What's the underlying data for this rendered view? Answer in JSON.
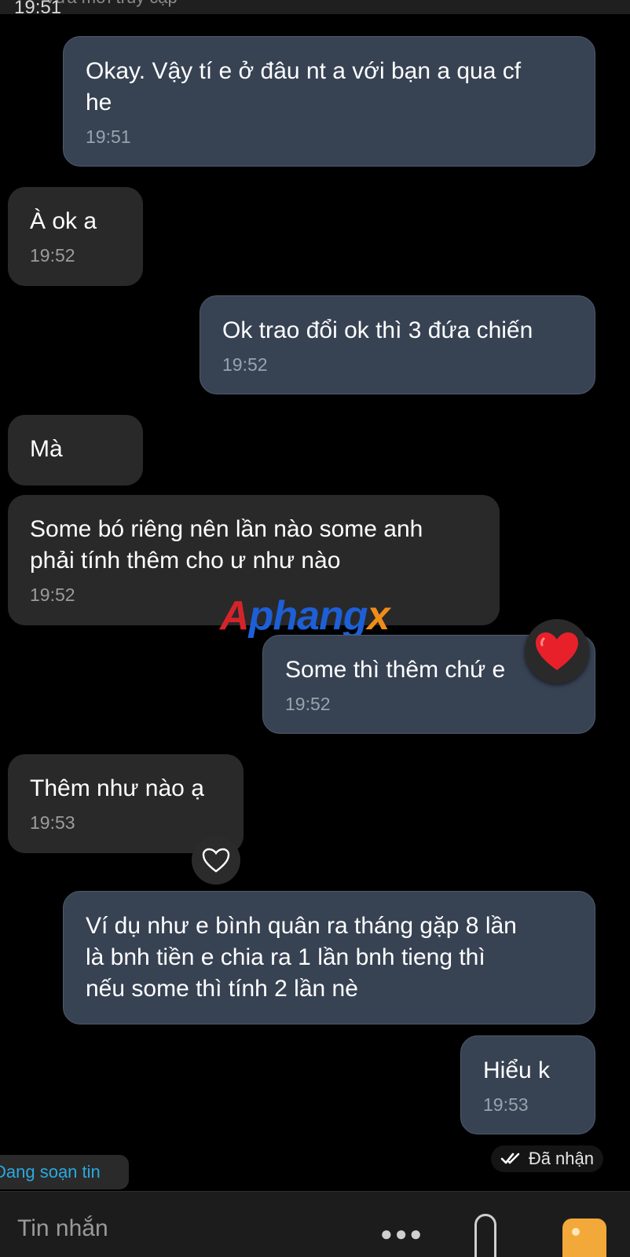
{
  "header": {
    "access_status": "Vừa mới truy cập",
    "previous_time": "19:51"
  },
  "messages": [
    {
      "direction": "out",
      "text": "Okay. Vậy tí e ở đâu nt a với bạn a qua cf\nhe",
      "time": "19:51"
    },
    {
      "direction": "in",
      "text": "À ok a",
      "time": "19:52"
    },
    {
      "direction": "out",
      "text": "Ok trao đổi ok thì 3 đứa chiến",
      "time": "19:52"
    },
    {
      "direction": "in",
      "text": "Mà",
      "time": ""
    },
    {
      "direction": "in",
      "text": "Some bó riêng nên lần nào some anh\nphải tính thêm cho ư như nào",
      "time": "19:52"
    },
    {
      "direction": "out",
      "text": "Some thì thêm chứ e",
      "time": "19:52",
      "reaction": "red-heart-icon"
    },
    {
      "direction": "in",
      "text": "Thêm như nào ạ",
      "time": "19:53",
      "reaction": "heart-outline-icon"
    },
    {
      "direction": "out",
      "text": "Ví dụ như e bình quân ra tháng gặp 8 lần\nlà bnh tiền e chia ra 1 lần bnh tieng thì\nnếu some thì tính 2 lần nè",
      "time": ""
    },
    {
      "direction": "out",
      "text": "Hiểu k",
      "time": "19:53"
    }
  ],
  "watermark": {
    "text_a": "A",
    "text_main": "phang",
    "text_x": "x"
  },
  "status": {
    "label": "Đã nhận"
  },
  "typing": {
    "label": "Đang soạn tin"
  },
  "composer": {
    "placeholder": "Tin nhắn"
  },
  "colors": {
    "outgoing_bubble": "#374253",
    "incoming_bubble": "#292929",
    "typing_text": "#2aa9e0",
    "heart": "#e8202a"
  }
}
